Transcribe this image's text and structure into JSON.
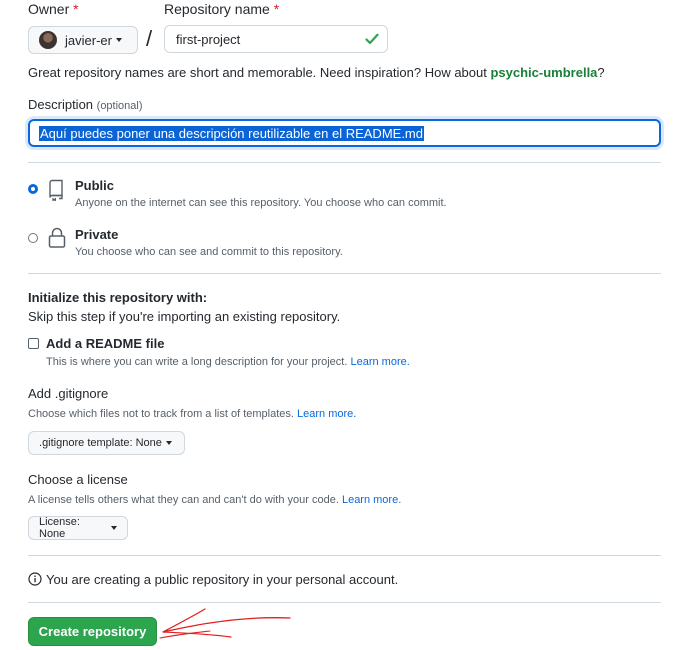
{
  "owner": {
    "label": "Owner",
    "required_mark": "*",
    "value": "javier-er"
  },
  "repo": {
    "label": "Repository name",
    "required_mark": "*",
    "value": "first-project",
    "separator": "/"
  },
  "suggestion": {
    "text": "Great repository names are short and memorable. Need inspiration? How about",
    "name": "psychic-umbrella",
    "end": "?"
  },
  "description": {
    "label": "Description",
    "optional": "(optional)",
    "value": "Aquí puedes poner una descripción reutilizable en el README.md"
  },
  "visibility": {
    "public": {
      "title": "Public",
      "desc": "Anyone on the internet can see this repository. You choose who can commit.",
      "checked": true
    },
    "private": {
      "title": "Private",
      "desc": "You choose who can see and commit to this repository.",
      "checked": false
    }
  },
  "init": {
    "heading": "Initialize this repository with:",
    "subtext": "Skip this step if you're importing an existing repository.",
    "readme": {
      "label": "Add a README file",
      "desc": "This is where you can write a long description for your project.",
      "link": "Learn more.",
      "checked": false
    },
    "gitignore": {
      "label": "Add .gitignore",
      "desc": "Choose which files not to track from a list of templates.",
      "link": "Learn more.",
      "button": "gitignore template: None"
    },
    "license": {
      "label": "Choose a license",
      "desc": "A license tells others what they can and can't do with your code.",
      "link": "Learn more.",
      "button": "License: None"
    }
  },
  "notice": "You are creating a public repository in your personal account.",
  "submit": {
    "label": "Create repository"
  },
  "colors": {
    "accent": "#0969da",
    "success": "#2da44e",
    "required": "#cf222e",
    "annotation": "#e02020"
  }
}
